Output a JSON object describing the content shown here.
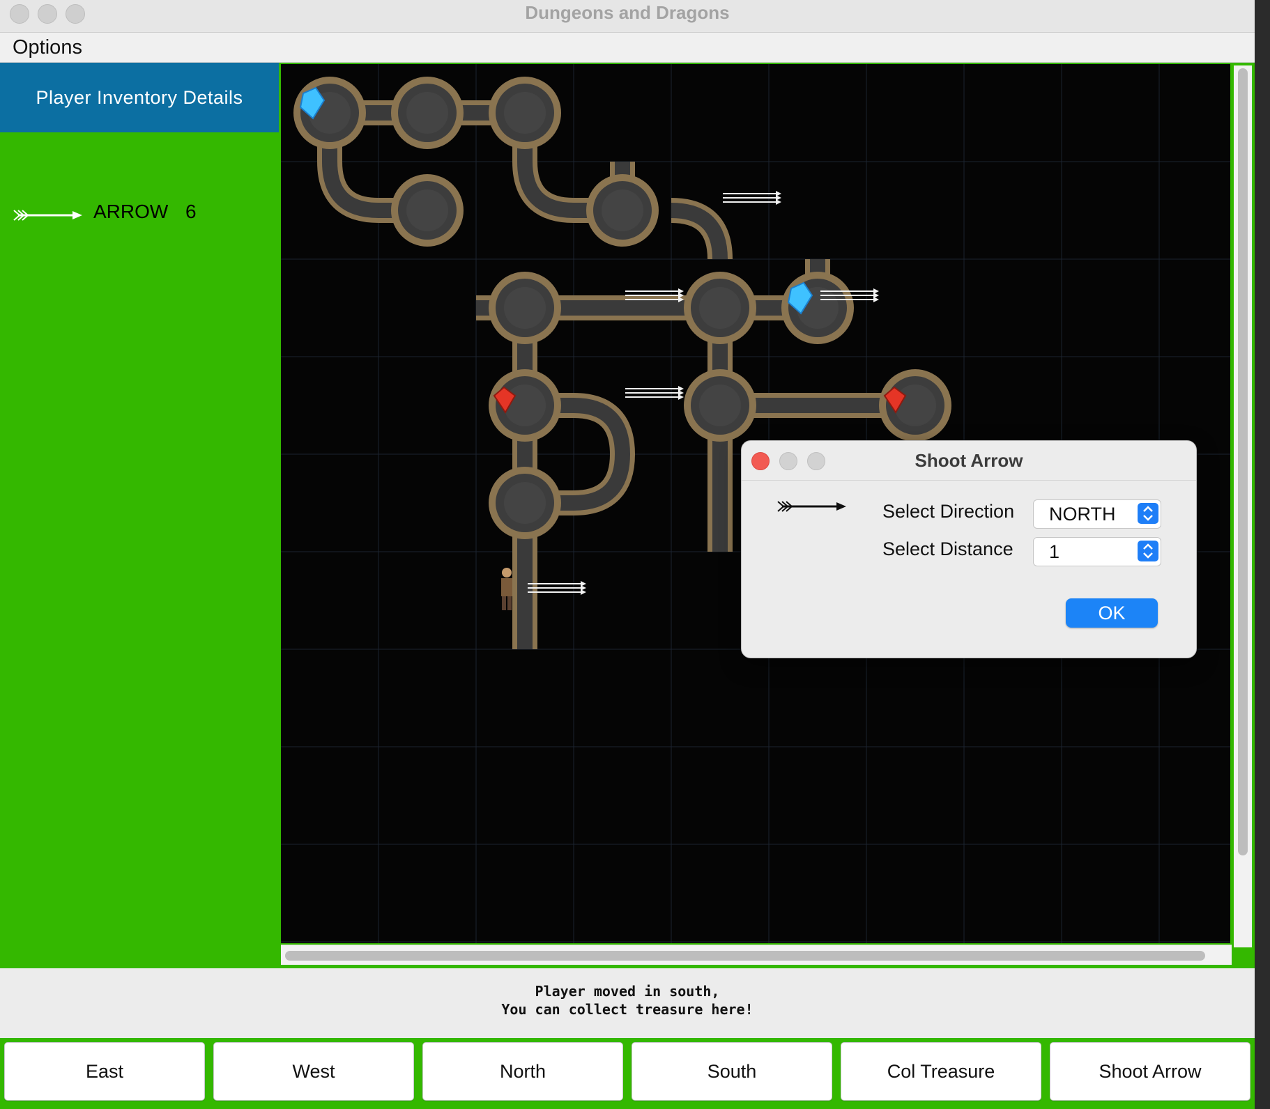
{
  "window": {
    "title": "Dungeons and Dragons"
  },
  "menu": {
    "options_label": "Options"
  },
  "inventory": {
    "header": "Player Inventory Details",
    "items": [
      {
        "icon": "arrow-icon",
        "name": "ARROW",
        "count": "6"
      }
    ]
  },
  "map": {
    "grid_cols": 10,
    "grid_rows": 10,
    "caves": [
      {
        "r": 0,
        "c": 0,
        "e": [
          "e",
          "s"
        ]
      },
      {
        "r": 0,
        "c": 1,
        "e": [
          "e",
          "w"
        ]
      },
      {
        "r": 0,
        "c": 2,
        "e": [
          "w",
          "s"
        ]
      },
      {
        "r": 1,
        "c": 1,
        "e": [
          "w"
        ]
      },
      {
        "r": 1,
        "c": 3,
        "e": [
          "w",
          "n"
        ]
      },
      {
        "r": 2,
        "c": 2,
        "e": [
          "w",
          "e",
          "s"
        ]
      },
      {
        "r": 2,
        "c": 4,
        "e": [
          "w",
          "e",
          "s"
        ]
      },
      {
        "r": 2,
        "c": 5,
        "e": [
          "w",
          "n"
        ]
      },
      {
        "r": 3,
        "c": 2,
        "e": [
          "n",
          "s",
          "e"
        ]
      },
      {
        "r": 3,
        "c": 4,
        "e": [
          "n",
          "e",
          "s"
        ]
      },
      {
        "r": 3,
        "c": 6,
        "e": [
          "w"
        ]
      },
      {
        "r": 4,
        "c": 2,
        "e": [
          "n",
          "s",
          "e"
        ]
      }
    ],
    "tunnels": [
      {
        "r": 1,
        "c": 0,
        "shape": "north-east"
      },
      {
        "r": 1,
        "c": 2,
        "shape": "north-east"
      },
      {
        "r": 1,
        "c": 4,
        "shape": "west-south"
      },
      {
        "r": 2,
        "c": 3,
        "shape": "horizontal"
      },
      {
        "r": 3,
        "c": 3,
        "shape": "west-south"
      },
      {
        "r": 3,
        "c": 5,
        "shape": "horizontal"
      },
      {
        "r": 4,
        "c": 3,
        "shape": "north-west"
      },
      {
        "r": 4,
        "c": 4,
        "shape": "vertical"
      },
      {
        "r": 5,
        "c": 2,
        "shape": "vertical"
      }
    ],
    "items": [
      {
        "r": 0,
        "c": 0,
        "type": "diamond-icon"
      },
      {
        "r": 2,
        "c": 5,
        "type": "diamond-icon"
      },
      {
        "r": 3,
        "c": 2,
        "type": "ruby-icon"
      },
      {
        "r": 3,
        "c": 6,
        "type": "ruby-icon"
      },
      {
        "r": 1,
        "c": 4,
        "type": "arrows-icon"
      },
      {
        "r": 2,
        "c": 3,
        "type": "arrows-icon"
      },
      {
        "r": 2,
        "c": 5,
        "type": "arrows-icon"
      },
      {
        "r": 3,
        "c": 3,
        "type": "arrows-icon"
      },
      {
        "r": 5,
        "c": 2,
        "type": "arrows-icon"
      }
    ],
    "player": {
      "r": 5,
      "c": 2
    }
  },
  "status": {
    "line1": "Player moved in south,",
    "line2": "You can collect treasure here!"
  },
  "buttons": {
    "east": "East",
    "west": "West",
    "north": "North",
    "south": "South",
    "collect": "Col Treasure",
    "shoot": "Shoot Arrow"
  },
  "dialog": {
    "title": "Shoot Arrow",
    "direction_label": "Select Direction",
    "direction_value": "NORTH",
    "distance_label": "Select Distance",
    "distance_value": "1",
    "ok_label": "OK"
  },
  "colors": {
    "panel_green": "#34b800",
    "header_blue": "#0c6fa2",
    "accent_blue": "#1c84f7",
    "close_red": "#f25a52"
  }
}
